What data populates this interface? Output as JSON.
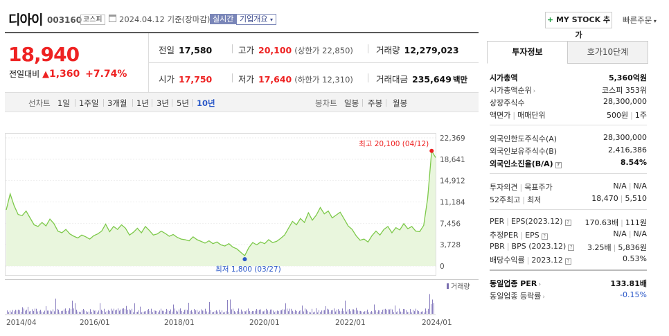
{
  "header": {
    "name": "디아이",
    "code": "003160",
    "market": "코스피",
    "date": "2024.04.12 기준(장마감)",
    "realtime": "실시간",
    "overview": "기업개요",
    "mystock": "MY STOCK 추가",
    "quick_order": "빠른주문"
  },
  "price": {
    "current": "18,940",
    "change_label": "전일대비",
    "change_amount": "1,360",
    "change_pct": "+7.74%",
    "prev_close_label": "전일",
    "prev_close": "17,580",
    "high_label": "고가",
    "high": "20,100",
    "upper_limit": "(상한가 22,850)",
    "volume_label": "거래량",
    "volume": "12,279,023",
    "open_label": "시가",
    "open": "17,750",
    "low_label": "저가",
    "low": "17,640",
    "lower_limit": "(하한가 12,310)",
    "amount_label": "거래대금",
    "amount": "235,649",
    "amount_unit": "백만"
  },
  "periods": {
    "line_label": "선차트",
    "items": [
      "1일",
      "1주일",
      "3개월",
      "1년",
      "3년",
      "5년",
      "10년"
    ],
    "active": "10년",
    "candle_label": "봉차트",
    "candle_items": [
      "일봉",
      "주봉",
      "월봉"
    ]
  },
  "chart_data": {
    "type": "line",
    "ylim": [
      0,
      22369
    ],
    "yticks": [
      "22,369",
      "18,641",
      "14,912",
      "11,184",
      "7,456",
      "3,728",
      "0"
    ],
    "xticks": [
      "2014/04",
      "2016/01",
      "2018/01",
      "2020/01",
      "2022/01",
      "2024/01"
    ],
    "max_label": "최고 20,100 (04/12)",
    "min_label": "최저 1,800 (03/27)",
    "volume_label": "거래량",
    "series": [
      {
        "values": [
          9800,
          12600,
          10500,
          9000,
          8800,
          9600,
          8400,
          7200,
          6900,
          7600,
          7000,
          8200,
          7400,
          6100,
          5800,
          6400,
          5600,
          5200,
          4900,
          5400,
          5100,
          4700,
          5300,
          5600,
          6100,
          7300,
          6000,
          6900,
          6400,
          7200,
          6600,
          5400,
          5900,
          6600,
          5800,
          6900,
          6200,
          5400,
          5600,
          6100,
          5700,
          5200,
          5500,
          5000,
          4700,
          4600,
          4400,
          5100,
          4600,
          4300,
          4000,
          4400,
          3900,
          4200,
          3700,
          3500,
          3900,
          3300,
          3000,
          2400,
          1800,
          3200,
          4100,
          3700,
          4200,
          3900,
          4600,
          4100,
          4300,
          4800,
          5400,
          6600,
          7800,
          7200,
          8300,
          7600,
          9300,
          8000,
          8900,
          10200,
          9100,
          9600,
          8400,
          8900,
          9400,
          8200,
          7000,
          6400,
          5300,
          4500,
          4700,
          4200,
          5300,
          6100,
          5400,
          6400,
          6900,
          5800,
          6700,
          6300,
          7400,
          6500,
          6900,
          6100,
          6000,
          7100,
          11800,
          20100,
          18940
        ]
      }
    ]
  },
  "sidebar": {
    "tab_info": "투자정보",
    "tab_quotes": "호가10단계",
    "rows1": [
      {
        "k": "시가총액",
        "v": "5,360억원"
      },
      {
        "k": "시가총액순위",
        "v": "코스피 353위"
      },
      {
        "k": "상장주식수",
        "v": "28,300,000"
      },
      {
        "k1": "액면가",
        "k2": "매매단위",
        "v1": "500원",
        "v2": "1주"
      }
    ],
    "rows2": [
      {
        "k": "외국인한도주식수(A)",
        "v": "28,300,000"
      },
      {
        "k": "외국인보유주식수(B)",
        "v": "2,416,386"
      },
      {
        "k": "외국인소진율(B/A)",
        "v": "8.54%"
      }
    ],
    "rows3": [
      {
        "k1": "투자의견",
        "k2": "목표주가",
        "v1": "N/A",
        "v2": "N/A"
      },
      {
        "k1": "52주최고",
        "k2": "최저",
        "v1": "18,470",
        "v2": "5,510"
      }
    ],
    "rows4": [
      {
        "k1": "PER",
        "k2": "EPS(2023.12)",
        "v1": "170.63배",
        "v2": "111원"
      },
      {
        "k1": "추정PER",
        "k2": "EPS",
        "v1": "N/A",
        "v2": "N/A"
      },
      {
        "k1": "PBR",
        "k2": "BPS (2023.12)",
        "v1": "3.25배",
        "v2": "5,836원"
      },
      {
        "k1": "배당수익률",
        "k2": "2023.12",
        "v1": "0.53%"
      }
    ],
    "rows5": [
      {
        "k": "동일업종 PER",
        "v": "133.81배"
      },
      {
        "k": "동일업종 등락률",
        "v": "-0.15%"
      }
    ]
  }
}
